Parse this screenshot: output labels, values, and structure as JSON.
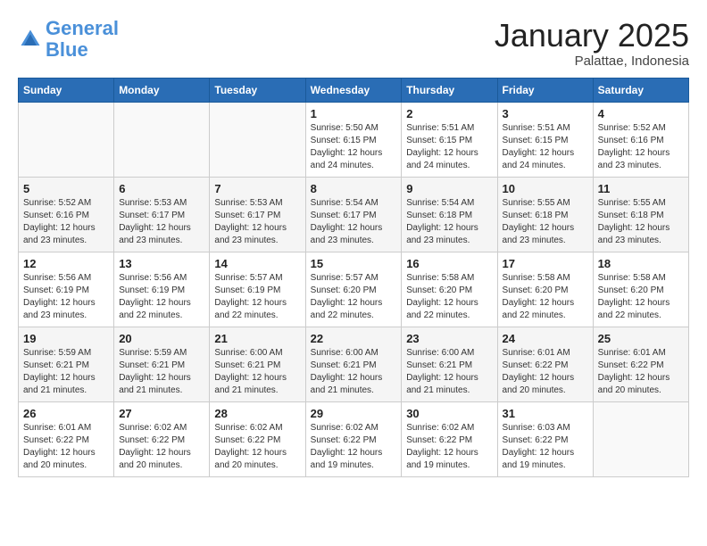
{
  "header": {
    "logo_line1": "General",
    "logo_line2": "Blue",
    "title": "January 2025",
    "subtitle": "Palattae, Indonesia"
  },
  "weekdays": [
    "Sunday",
    "Monday",
    "Tuesday",
    "Wednesday",
    "Thursday",
    "Friday",
    "Saturday"
  ],
  "weeks": [
    [
      {
        "day": "",
        "sunrise": "",
        "sunset": "",
        "daylight": ""
      },
      {
        "day": "",
        "sunrise": "",
        "sunset": "",
        "daylight": ""
      },
      {
        "day": "",
        "sunrise": "",
        "sunset": "",
        "daylight": ""
      },
      {
        "day": "1",
        "sunrise": "Sunrise: 5:50 AM",
        "sunset": "Sunset: 6:15 PM",
        "daylight": "Daylight: 12 hours and 24 minutes."
      },
      {
        "day": "2",
        "sunrise": "Sunrise: 5:51 AM",
        "sunset": "Sunset: 6:15 PM",
        "daylight": "Daylight: 12 hours and 24 minutes."
      },
      {
        "day": "3",
        "sunrise": "Sunrise: 5:51 AM",
        "sunset": "Sunset: 6:15 PM",
        "daylight": "Daylight: 12 hours and 24 minutes."
      },
      {
        "day": "4",
        "sunrise": "Sunrise: 5:52 AM",
        "sunset": "Sunset: 6:16 PM",
        "daylight": "Daylight: 12 hours and 23 minutes."
      }
    ],
    [
      {
        "day": "5",
        "sunrise": "Sunrise: 5:52 AM",
        "sunset": "Sunset: 6:16 PM",
        "daylight": "Daylight: 12 hours and 23 minutes."
      },
      {
        "day": "6",
        "sunrise": "Sunrise: 5:53 AM",
        "sunset": "Sunset: 6:17 PM",
        "daylight": "Daylight: 12 hours and 23 minutes."
      },
      {
        "day": "7",
        "sunrise": "Sunrise: 5:53 AM",
        "sunset": "Sunset: 6:17 PM",
        "daylight": "Daylight: 12 hours and 23 minutes."
      },
      {
        "day": "8",
        "sunrise": "Sunrise: 5:54 AM",
        "sunset": "Sunset: 6:17 PM",
        "daylight": "Daylight: 12 hours and 23 minutes."
      },
      {
        "day": "9",
        "sunrise": "Sunrise: 5:54 AM",
        "sunset": "Sunset: 6:18 PM",
        "daylight": "Daylight: 12 hours and 23 minutes."
      },
      {
        "day": "10",
        "sunrise": "Sunrise: 5:55 AM",
        "sunset": "Sunset: 6:18 PM",
        "daylight": "Daylight: 12 hours and 23 minutes."
      },
      {
        "day": "11",
        "sunrise": "Sunrise: 5:55 AM",
        "sunset": "Sunset: 6:18 PM",
        "daylight": "Daylight: 12 hours and 23 minutes."
      }
    ],
    [
      {
        "day": "12",
        "sunrise": "Sunrise: 5:56 AM",
        "sunset": "Sunset: 6:19 PM",
        "daylight": "Daylight: 12 hours and 23 minutes."
      },
      {
        "day": "13",
        "sunrise": "Sunrise: 5:56 AM",
        "sunset": "Sunset: 6:19 PM",
        "daylight": "Daylight: 12 hours and 22 minutes."
      },
      {
        "day": "14",
        "sunrise": "Sunrise: 5:57 AM",
        "sunset": "Sunset: 6:19 PM",
        "daylight": "Daylight: 12 hours and 22 minutes."
      },
      {
        "day": "15",
        "sunrise": "Sunrise: 5:57 AM",
        "sunset": "Sunset: 6:20 PM",
        "daylight": "Daylight: 12 hours and 22 minutes."
      },
      {
        "day": "16",
        "sunrise": "Sunrise: 5:58 AM",
        "sunset": "Sunset: 6:20 PM",
        "daylight": "Daylight: 12 hours and 22 minutes."
      },
      {
        "day": "17",
        "sunrise": "Sunrise: 5:58 AM",
        "sunset": "Sunset: 6:20 PM",
        "daylight": "Daylight: 12 hours and 22 minutes."
      },
      {
        "day": "18",
        "sunrise": "Sunrise: 5:58 AM",
        "sunset": "Sunset: 6:20 PM",
        "daylight": "Daylight: 12 hours and 22 minutes."
      }
    ],
    [
      {
        "day": "19",
        "sunrise": "Sunrise: 5:59 AM",
        "sunset": "Sunset: 6:21 PM",
        "daylight": "Daylight: 12 hours and 21 minutes."
      },
      {
        "day": "20",
        "sunrise": "Sunrise: 5:59 AM",
        "sunset": "Sunset: 6:21 PM",
        "daylight": "Daylight: 12 hours and 21 minutes."
      },
      {
        "day": "21",
        "sunrise": "Sunrise: 6:00 AM",
        "sunset": "Sunset: 6:21 PM",
        "daylight": "Daylight: 12 hours and 21 minutes."
      },
      {
        "day": "22",
        "sunrise": "Sunrise: 6:00 AM",
        "sunset": "Sunset: 6:21 PM",
        "daylight": "Daylight: 12 hours and 21 minutes."
      },
      {
        "day": "23",
        "sunrise": "Sunrise: 6:00 AM",
        "sunset": "Sunset: 6:21 PM",
        "daylight": "Daylight: 12 hours and 21 minutes."
      },
      {
        "day": "24",
        "sunrise": "Sunrise: 6:01 AM",
        "sunset": "Sunset: 6:22 PM",
        "daylight": "Daylight: 12 hours and 20 minutes."
      },
      {
        "day": "25",
        "sunrise": "Sunrise: 6:01 AM",
        "sunset": "Sunset: 6:22 PM",
        "daylight": "Daylight: 12 hours and 20 minutes."
      }
    ],
    [
      {
        "day": "26",
        "sunrise": "Sunrise: 6:01 AM",
        "sunset": "Sunset: 6:22 PM",
        "daylight": "Daylight: 12 hours and 20 minutes."
      },
      {
        "day": "27",
        "sunrise": "Sunrise: 6:02 AM",
        "sunset": "Sunset: 6:22 PM",
        "daylight": "Daylight: 12 hours and 20 minutes."
      },
      {
        "day": "28",
        "sunrise": "Sunrise: 6:02 AM",
        "sunset": "Sunset: 6:22 PM",
        "daylight": "Daylight: 12 hours and 20 minutes."
      },
      {
        "day": "29",
        "sunrise": "Sunrise: 6:02 AM",
        "sunset": "Sunset: 6:22 PM",
        "daylight": "Daylight: 12 hours and 19 minutes."
      },
      {
        "day": "30",
        "sunrise": "Sunrise: 6:02 AM",
        "sunset": "Sunset: 6:22 PM",
        "daylight": "Daylight: 12 hours and 19 minutes."
      },
      {
        "day": "31",
        "sunrise": "Sunrise: 6:03 AM",
        "sunset": "Sunset: 6:22 PM",
        "daylight": "Daylight: 12 hours and 19 minutes."
      },
      {
        "day": "",
        "sunrise": "",
        "sunset": "",
        "daylight": ""
      }
    ]
  ]
}
